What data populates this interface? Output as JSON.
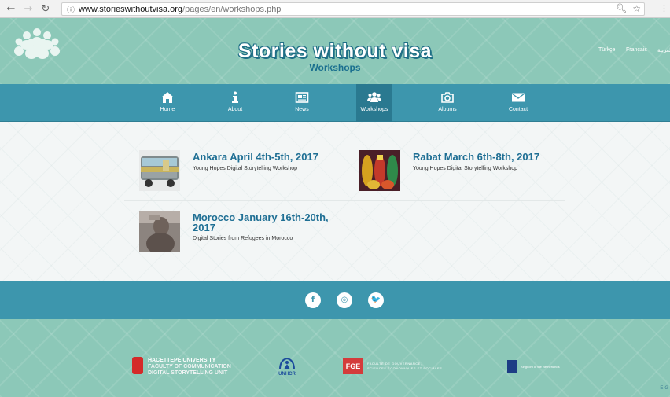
{
  "browser": {
    "back_icon": "arrow-left-icon",
    "forward_icon": "arrow-right-icon",
    "reload_icon": "reload-icon",
    "url_host": "www.storieswithoutvisa.org",
    "url_path": "/pages/en/workshops.php",
    "zoom_icon": "magnifier-icon",
    "bookmark_icon": "star-icon"
  },
  "header": {
    "title": "Stories without visa",
    "subtitle": "Workshops",
    "languages": [
      "Türkçe",
      "Français",
      "العربية"
    ],
    "logo_icon": "people-group-icon"
  },
  "nav": {
    "items": [
      {
        "label": "Home",
        "icon": "home-icon"
      },
      {
        "label": "About",
        "icon": "info-icon"
      },
      {
        "label": "News",
        "icon": "newspaper-icon"
      },
      {
        "label": "Workshops",
        "icon": "users-icon",
        "active": true
      },
      {
        "label": "Albums",
        "icon": "camera-icon"
      },
      {
        "label": "Contact",
        "icon": "envelope-icon"
      }
    ]
  },
  "workshops": [
    {
      "title": "Ankara April 4th-5th, 2017",
      "description": "Young Hopes Digital Storytelling Workshop"
    },
    {
      "title": "Rabat March 6th-8th, 2017",
      "description": "Young Hopes Digital Storytelling Workshop"
    },
    {
      "title_line1": "Morocco January 16th-20th,",
      "title_line2": "2017",
      "description": "Digital Stories from Refugees in Morocco"
    }
  ],
  "social": [
    {
      "icon": "facebook-icon",
      "glyph": "f"
    },
    {
      "icon": "instagram-icon",
      "glyph": "◎"
    },
    {
      "icon": "twitter-icon",
      "glyph": "🐦"
    }
  ],
  "footer": {
    "hacettepe": {
      "line1": "HACETTEPE UNIVERSITY",
      "line2": "FACULTY OF COMMUNICATION",
      "line3": "DIGITAL STORYTELLING UNIT"
    },
    "unhcr": "UNHCR",
    "fgse": {
      "mark": "FGE",
      "line1": "FACULTÉ DE GOUVERNANCE,",
      "line2": "SCIENCES ÉCONOMIQUES ET SOCIALES"
    },
    "netherlands": "Kingdom of the Netherlands",
    "corner": "E-G"
  },
  "colors": {
    "header_bg": "#8cc8b8",
    "nav_bg": "#3d96ad",
    "nav_active": "#2a7990",
    "title_blue": "#1f6f94"
  }
}
